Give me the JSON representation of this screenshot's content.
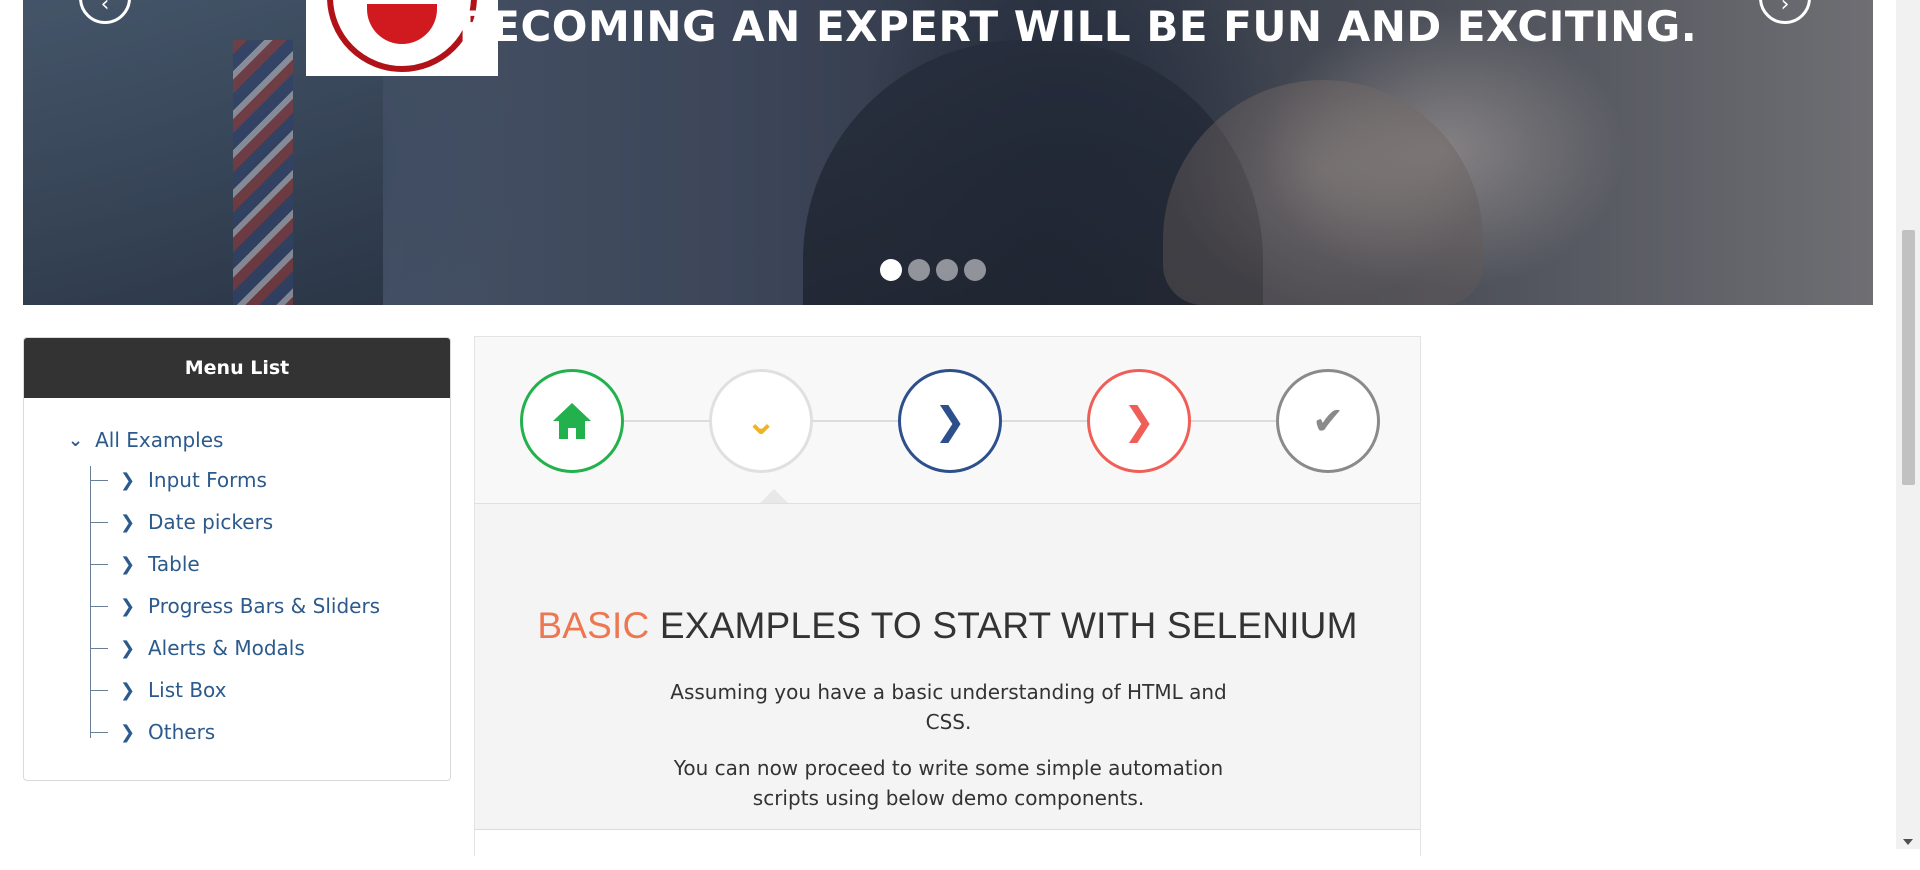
{
  "hero": {
    "title": "BECOMING AN EXPERT WILL BE FUN AND EXCITING.",
    "slides_total": 4,
    "active_slide": 1
  },
  "menu": {
    "title": "Menu List",
    "root_label": "All Examples",
    "items": [
      {
        "label": "Input Forms"
      },
      {
        "label": "Date pickers"
      },
      {
        "label": "Table"
      },
      {
        "label": "Progress Bars & Sliders"
      },
      {
        "label": "Alerts & Modals"
      },
      {
        "label": "List Box"
      },
      {
        "label": "Others"
      }
    ],
    "link_color": "#2c5a8c"
  },
  "steps": [
    {
      "icon": "home-icon",
      "color": "#22b14c"
    },
    {
      "icon": "chevron-down-icon",
      "color": "#f0b323"
    },
    {
      "icon": "chevron-right-icon",
      "color": "#2d4f8c"
    },
    {
      "icon": "chevron-right-icon",
      "color": "#ef5f57"
    },
    {
      "icon": "check-icon",
      "color": "#8a8a8a"
    }
  ],
  "main": {
    "title_accent": "BASIC",
    "title_rest": " EXAMPLES TO START WITH SELENIUM",
    "paragraph_1": "Assuming you have a basic understanding of HTML and CSS.",
    "paragraph_2": "You can now proceed to write some simple automation scripts using below demo components.",
    "accent_color": "#ee7752"
  }
}
